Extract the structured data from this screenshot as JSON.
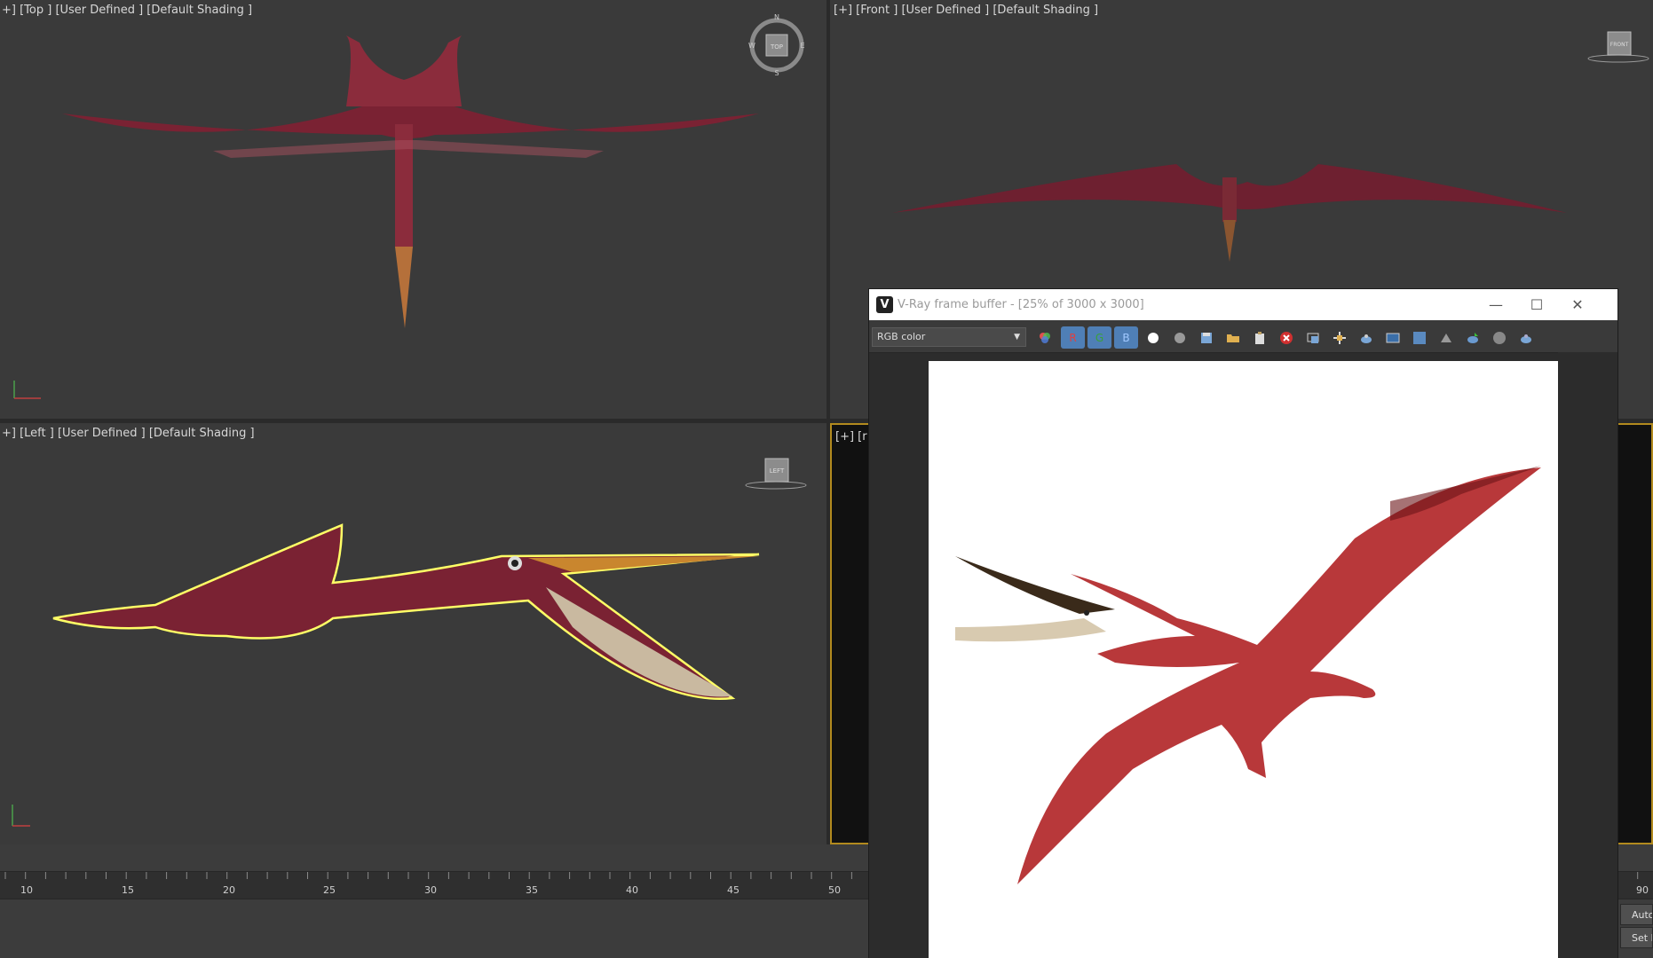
{
  "viewports": {
    "top": {
      "label": "+] [Top ] [User Defined ] [Default Shading ]",
      "cube": "TOP",
      "compass": {
        "n": "N",
        "s": "S",
        "e": "E",
        "w": "W"
      }
    },
    "front": {
      "label": "[+] [Front ] [User Defined ] [Default Shading ]",
      "cube": "FRONT"
    },
    "left": {
      "label": "+] [Left ] [User Defined ] [Default Shading ]",
      "cube": "LEFT"
    },
    "perspective": {
      "label": "[+] [r"
    }
  },
  "timeline": {
    "ticks": [
      "10",
      "15",
      "20",
      "25",
      "30",
      "35",
      "40",
      "45",
      "50"
    ],
    "right_tick": "90",
    "auto_key_label": "Auto",
    "set_key_label": "Set K"
  },
  "frame_buffer": {
    "title": "V-Ray frame buffer - [25% of 3000 x 3000]",
    "channel": "RGB color",
    "channel_buttons": [
      "R",
      "G",
      "B"
    ],
    "toolbar_icons": [
      "color-channels-icon",
      "white-circle-icon",
      "gray-circle-icon",
      "save-icon",
      "open-folder-icon",
      "clipboard-icon",
      "clear-icon",
      "region-icon",
      "track-mouse-icon",
      "render-teapot-icon",
      "lut-icon",
      "zoom-icon",
      "lens-effects-icon",
      "render-icon",
      "stop-icon",
      "teapot-icon"
    ],
    "colors": {
      "title_bg": "#ffffff",
      "toolbar_bg": "#3a3a3a",
      "channel_btn": "#4f7fb6"
    }
  },
  "colors": {
    "viewport_bg": "#3a3a3a",
    "selection_outline": "#ffff66",
    "creature_red": "#8b2a3a"
  }
}
